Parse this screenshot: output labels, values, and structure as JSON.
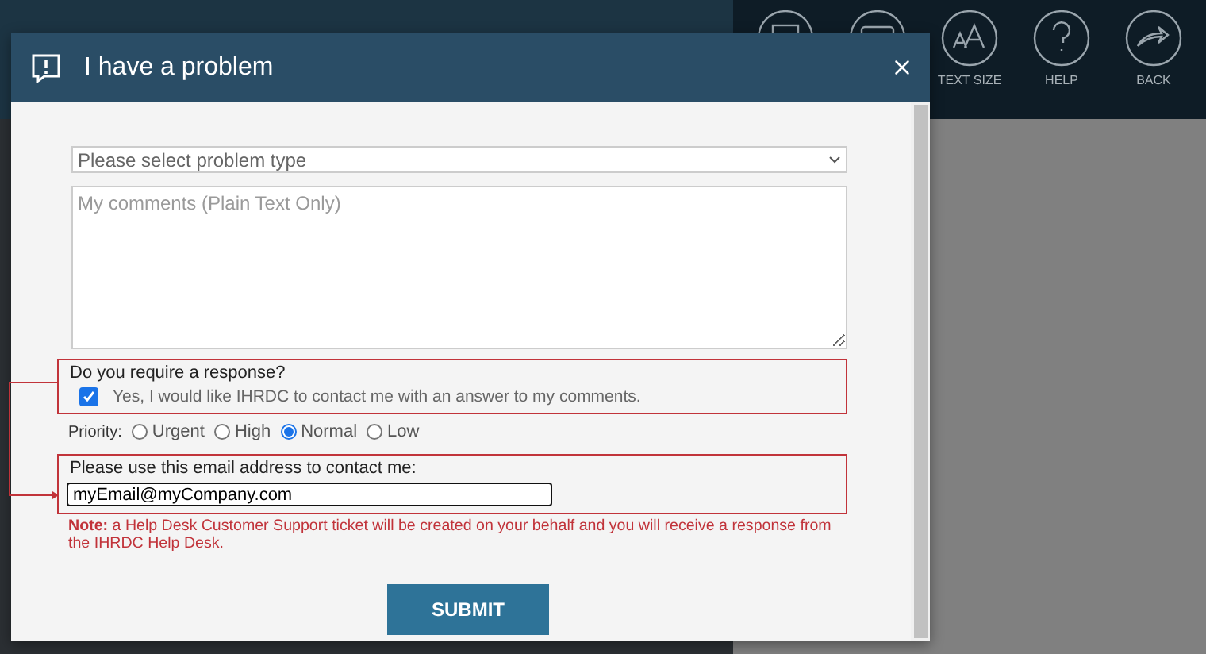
{
  "toolbar": [
    {
      "kind": "calendar"
    },
    {
      "kind": "chat"
    },
    {
      "kind": "text-size",
      "label": "TEXT SIZE"
    },
    {
      "kind": "help",
      "label": "HELP"
    },
    {
      "kind": "back",
      "label": "BACK"
    }
  ],
  "dialog": {
    "title": "I have a problem",
    "problem_type": {
      "placeholder": "Please select problem type"
    },
    "comments": {
      "placeholder": "My comments (Plain Text Only)"
    },
    "response": {
      "question": "Do you require a response?",
      "checkbox_label": "Yes, I would like IHRDC to contact me with an answer to my comments.",
      "checked": true
    },
    "priority": {
      "label": "Priority:",
      "options": [
        {
          "label": "Urgent",
          "selected": false
        },
        {
          "label": "High",
          "selected": false
        },
        {
          "label": "Normal",
          "selected": true
        },
        {
          "label": "Low",
          "selected": false
        }
      ]
    },
    "email": {
      "label": "Please use this email address to contact me:",
      "value": "myEmail@myCompany.com"
    },
    "note": "**Note:** a Help Desk Customer Support ticket will be created on your behalf and you will receive a response from the IHRDC Help Desk.",
    "submit": "SUBMIT"
  }
}
